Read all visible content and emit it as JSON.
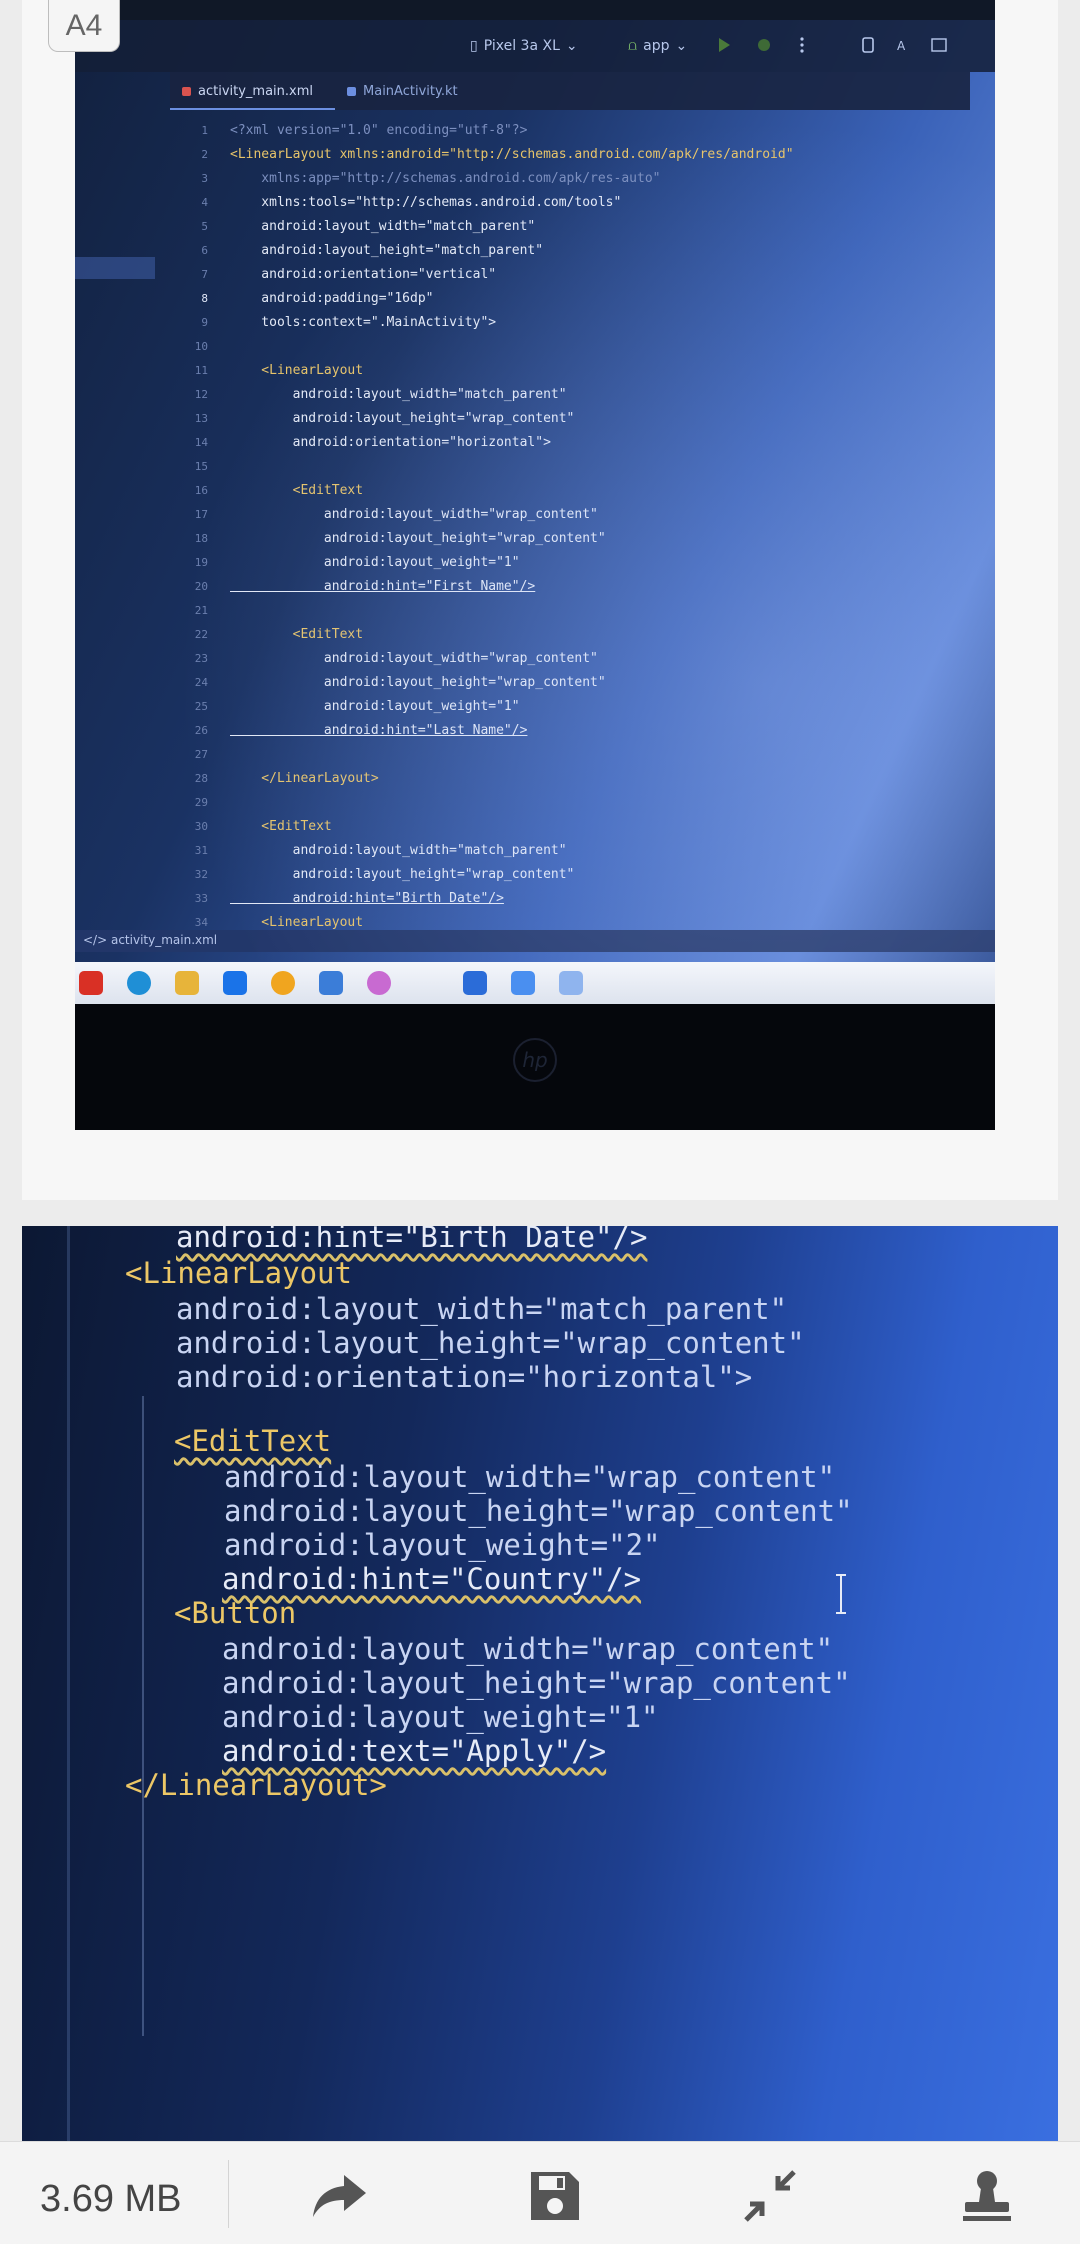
{
  "page_label": "A4",
  "ide": {
    "device": "Pixel 3a XL",
    "run_config": "app",
    "tabs": [
      {
        "label": "activity_main.xml",
        "active": true,
        "color": "#d9534f"
      },
      {
        "label": "MainActivity.kt",
        "active": false,
        "color": "#6c8fe0"
      }
    ],
    "status_file": "activity_main.xml",
    "lines": [
      {
        "n": "1",
        "code": "<?xml version=\"1.0\" encoding=\"utf-8\"?>",
        "style": "dim"
      },
      {
        "n": "2",
        "code": "<LinearLayout xmlns:android=\"http://schemas.android.com/apk/res/android\"",
        "style": "tag"
      },
      {
        "n": "3",
        "code": "    xmlns:app=\"http://schemas.android.com/apk/res-auto\"",
        "style": "dim"
      },
      {
        "n": "4",
        "code": "    xmlns:tools=\"http://schemas.android.com/tools\"",
        "style": "txt"
      },
      {
        "n": "5",
        "code": "    android:layout_width=\"match_parent\"",
        "style": "txt"
      },
      {
        "n": "6",
        "code": "    android:layout_height=\"match_parent\"",
        "style": "txt"
      },
      {
        "n": "7",
        "code": "    android:orientation=\"vertical\"",
        "style": "txt"
      },
      {
        "n": "8",
        "code": "    android:padding=\"16dp\"",
        "style": "txt",
        "current": true
      },
      {
        "n": "9",
        "code": "    tools:context=\".MainActivity\">",
        "style": "txt"
      },
      {
        "n": "10",
        "code": "",
        "style": "txt"
      },
      {
        "n": "11",
        "code": "    <LinearLayout",
        "style": "tag"
      },
      {
        "n": "12",
        "code": "        android:layout_width=\"match_parent\"",
        "style": "txt"
      },
      {
        "n": "13",
        "code": "        android:layout_height=\"wrap_content\"",
        "style": "txt"
      },
      {
        "n": "14",
        "code": "        android:orientation=\"horizontal\">",
        "style": "txt"
      },
      {
        "n": "15",
        "code": "",
        "style": "txt"
      },
      {
        "n": "16",
        "code": "        <EditText",
        "style": "tag"
      },
      {
        "n": "17",
        "code": "            android:layout_width=\"wrap_content\"",
        "style": "txt"
      },
      {
        "n": "18",
        "code": "            android:layout_height=\"wrap_content\"",
        "style": "txt"
      },
      {
        "n": "19",
        "code": "            android:layout_weight=\"1\"",
        "style": "txt"
      },
      {
        "n": "20",
        "code": "            android:hint=\"First Name\"/>",
        "style": "u"
      },
      {
        "n": "21",
        "code": "",
        "style": "txt"
      },
      {
        "n": "22",
        "code": "        <EditText",
        "style": "tag"
      },
      {
        "n": "23",
        "code": "            android:layout_width=\"wrap_content\"",
        "style": "txt"
      },
      {
        "n": "24",
        "code": "            android:layout_height=\"wrap_content\"",
        "style": "txt"
      },
      {
        "n": "25",
        "code": "            android:layout_weight=\"1\"",
        "style": "txt"
      },
      {
        "n": "26",
        "code": "            android:hint=\"Last Name\"/>",
        "style": "u"
      },
      {
        "n": "27",
        "code": "",
        "style": "txt"
      },
      {
        "n": "28",
        "code": "    </LinearLayout>",
        "style": "tag"
      },
      {
        "n": "29",
        "code": "",
        "style": "txt"
      },
      {
        "n": "30",
        "code": "    <EditText",
        "style": "tag"
      },
      {
        "n": "31",
        "code": "        android:layout_width=\"match_parent\"",
        "style": "txt"
      },
      {
        "n": "32",
        "code": "        android:layout_height=\"wrap_content\"",
        "style": "txt"
      },
      {
        "n": "33",
        "code": "        android:hint=\"Birth Date\"/>",
        "style": "u"
      },
      {
        "n": "34",
        "code": "    <LinearLayout",
        "style": "tag"
      }
    ]
  },
  "zoom_code": {
    "lines": [
      {
        "text": "android:hint=\"Birth Date\"/>",
        "style": "sq"
      },
      {
        "text": "<LinearLayout",
        "style": "tag"
      },
      {
        "text": "android:layout_width=\"match_parent\"",
        "style": "attr"
      },
      {
        "text": "android:layout_height=\"wrap_content\"",
        "style": "attr"
      },
      {
        "text": "android:orientation=\"horizontal\">",
        "style": "attr"
      },
      {
        "text": "<EditText",
        "style": "tag sq"
      },
      {
        "text": "android:layout_width=\"wrap_content\"",
        "style": "attr"
      },
      {
        "text": "android:layout_height=\"wrap_content\"",
        "style": "attr"
      },
      {
        "text": "android:layout_weight=\"2\"",
        "style": "attr"
      },
      {
        "text": "android:hint=\"Country\"/>",
        "style": "sq"
      },
      {
        "text": "<Button",
        "style": "tag"
      },
      {
        "text": "android:layout_width=\"wrap_content\"",
        "style": "attr"
      },
      {
        "text": "android:layout_height=\"wrap_content\"",
        "style": "attr"
      },
      {
        "text": "android:layout_weight=\"1\"",
        "style": "attr"
      },
      {
        "text": "android:text=\"Apply\"/>",
        "style": "sq"
      },
      {
        "text": "</LinearLayout>",
        "style": "tag"
      }
    ]
  },
  "bottom_bar": {
    "file_size": "3.69 MB",
    "actions": [
      {
        "icon": "share-arrow-icon"
      },
      {
        "icon": "save-floppy-icon"
      },
      {
        "icon": "compress-arrows-icon"
      },
      {
        "icon": "stamp-icon"
      }
    ],
    "icon_color": "#555555"
  }
}
